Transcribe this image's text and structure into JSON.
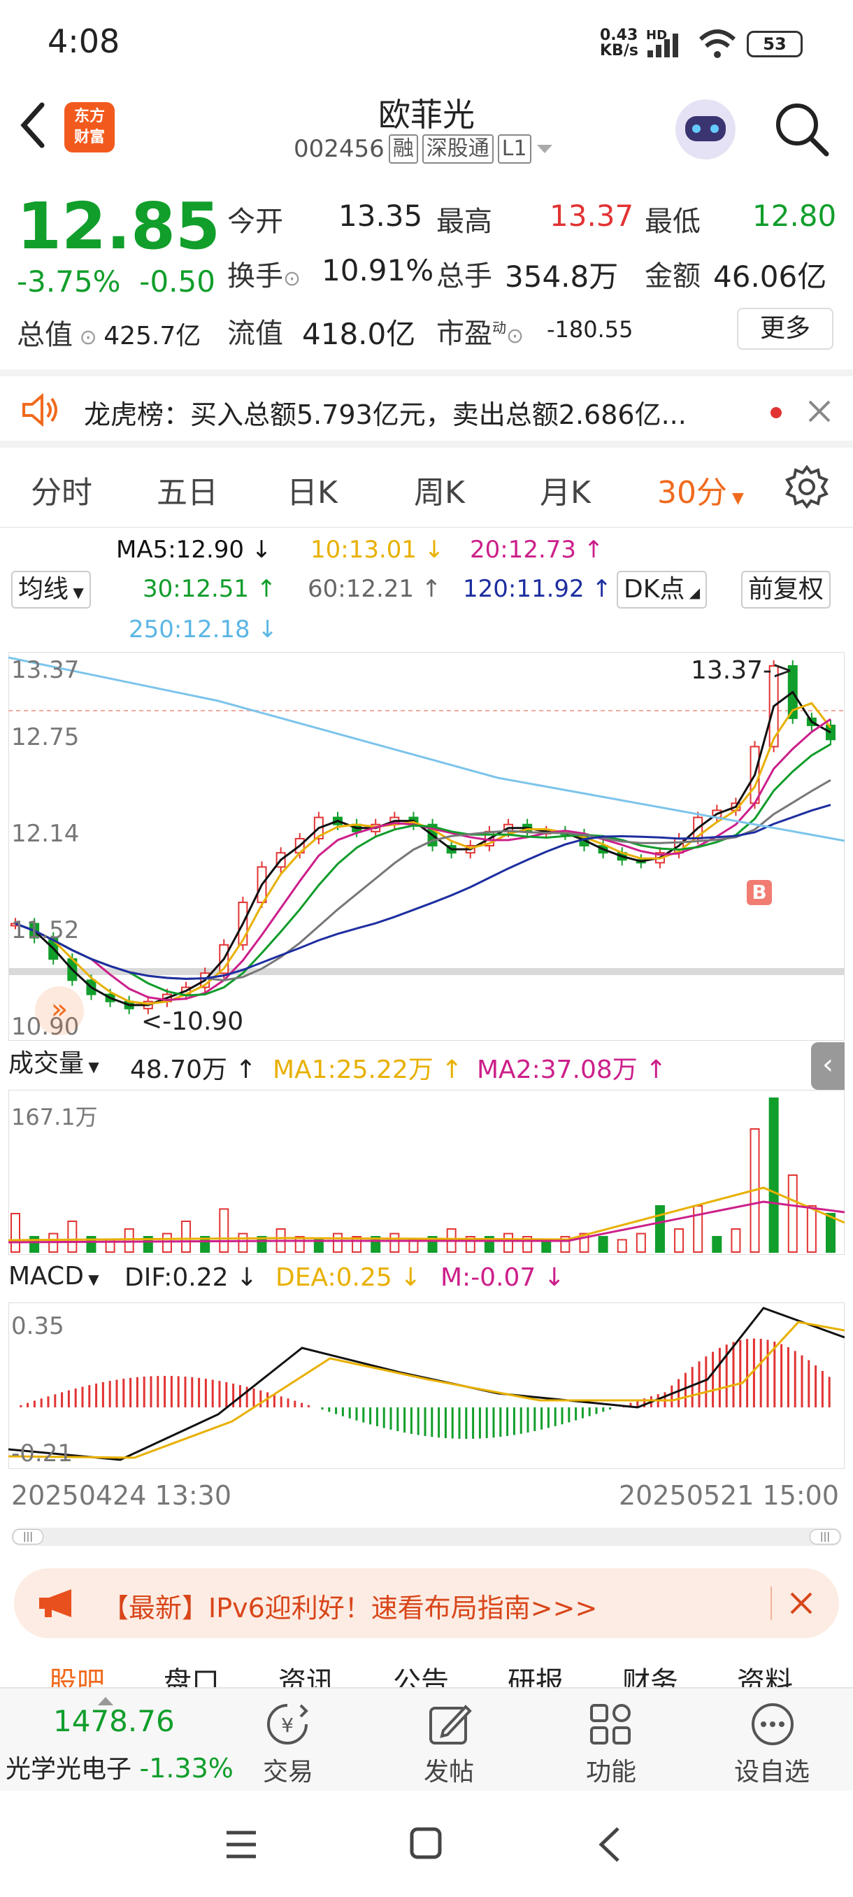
{
  "status_bar": {
    "time": "4:08",
    "net_speed": "0.43",
    "net_unit": "KB/s",
    "hd": "HD",
    "battery": "53"
  },
  "header": {
    "logo_line1": "东方",
    "logo_line2": "财富",
    "name": "欧菲光",
    "code": "002456",
    "tags": [
      "融",
      "深股通",
      "L1"
    ]
  },
  "quote": {
    "price": "12.85",
    "change_pct": "-3.75%",
    "change": "-0.50",
    "open_label": "今开",
    "open": "13.35",
    "high_label": "最高",
    "high": "13.37",
    "low_label": "最低",
    "low": "12.80",
    "turnover_label": "换手",
    "turnover": "10.91%",
    "volume_label": "总手",
    "volume": "354.8万",
    "amount_label": "金额",
    "amount": "46.06亿",
    "mktcap_label": "总值",
    "mktcap": "425.7亿",
    "float_label": "流值",
    "float": "418.0亿",
    "pe_label": "市盈",
    "pe_sup": "动",
    "pe": "-180.55",
    "more": "更多"
  },
  "notice": {
    "text": "龙虎榜：买入总额5.793亿元，卖出总额2.686亿..."
  },
  "tabs": [
    "分时",
    "五日",
    "日K",
    "周K",
    "月K",
    "30分",
    "设置"
  ],
  "active_tab": "30分",
  "ma": {
    "toggle": "均线",
    "ma5": "MA5:12.90 ↓",
    "ma10": "10:13.01 ↓",
    "ma20": "20:12.73 ↑",
    "ma30": "30:12.51 ↑",
    "ma60": "60:12.21 ↑",
    "ma120": "120:11.92 ↑",
    "ma250": "250:12.18 ↓",
    "dk": "DK点",
    "adjust": "前复权"
  },
  "chart_labels": {
    "y_top": "13.37",
    "y_2": "12.75",
    "y_3": "12.14",
    "y_4": "11.52",
    "y_bottom": "10.90",
    "high_mark": "13.37->",
    "low_mark": "<-10.90",
    "b_mark": "B"
  },
  "volume": {
    "toggle": "成交量",
    "vol": "48.70万 ↑",
    "ma1": "MA1:25.22万 ↑",
    "ma2": "MA2:37.08万 ↑",
    "ymax": "167.1万"
  },
  "macd": {
    "toggle": "MACD",
    "dif": "DIF:0.22 ↓",
    "dea": "DEA:0.25 ↓",
    "m": "M:-0.07 ↓",
    "y_top": "0.35",
    "y_bottom": "-0.21"
  },
  "dates": {
    "start": "20250424 13:30",
    "end": "20250521 15:00"
  },
  "ad": {
    "text": "【最新】IPv6迎利好！速看布局指南>>>"
  },
  "bottom_tabs": [
    "股吧",
    "盘口",
    "资讯",
    "公告",
    "研报",
    "财务",
    "资料"
  ],
  "bottom_bar": {
    "index_value": "1478.76",
    "index_name": "光学光电子",
    "index_change": "-1.33%",
    "trade": "交易",
    "post": "发帖",
    "function": "功能",
    "watchlist": "设自选"
  },
  "colors": {
    "up": "#e23333",
    "down": "#119e2b",
    "accent": "#f06a1d"
  },
  "chart_data": {
    "type": "candlestick",
    "price_axis": [
      13.37,
      12.75,
      12.14,
      11.52,
      10.9
    ],
    "high": 13.37,
    "low": 10.9,
    "volume_ymax": "167.1万",
    "macd_range": [
      -0.21,
      0.35
    ],
    "start": "20250424 13:30",
    "end": "20250521 15:00"
  }
}
